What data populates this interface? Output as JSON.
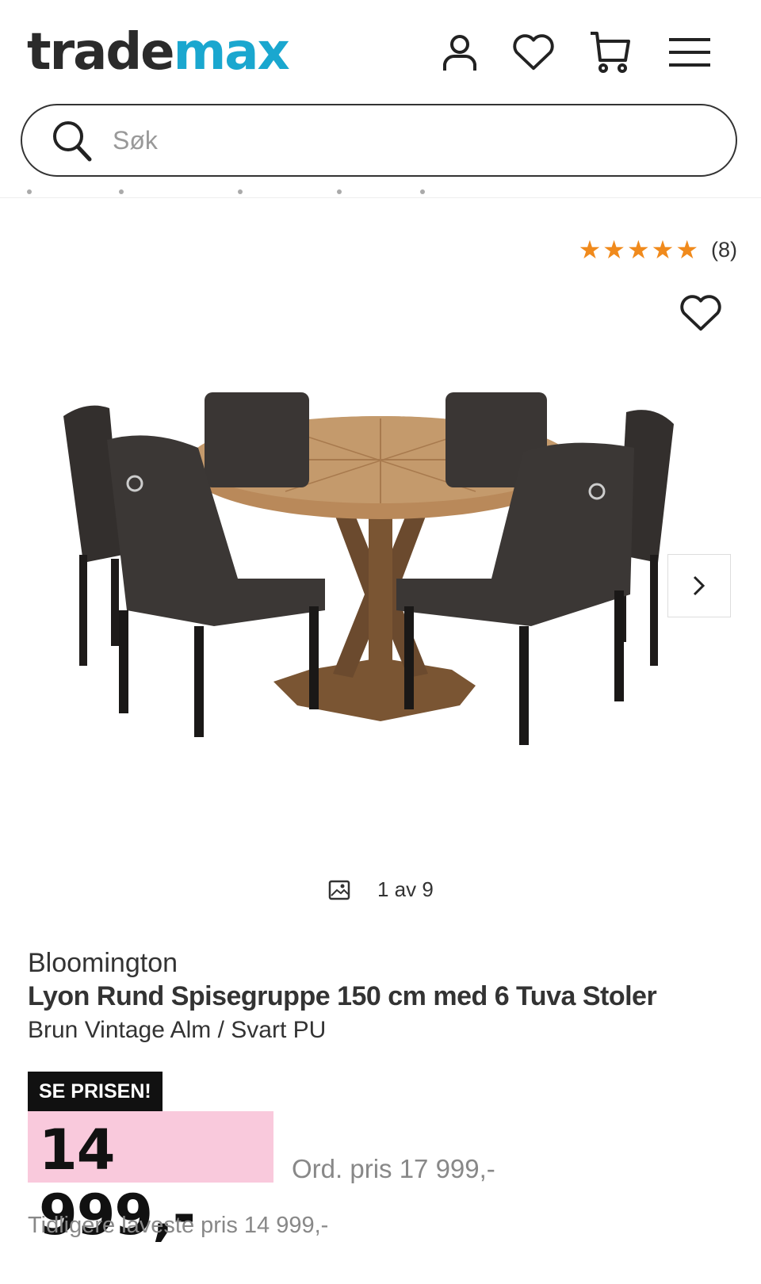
{
  "header": {
    "logo_part1": "trade",
    "logo_part2": "max",
    "search_placeholder": "Søk"
  },
  "rating": {
    "stars": "★★★★★",
    "value": 5,
    "count": "(8)"
  },
  "gallery": {
    "counter": "1 av 9"
  },
  "product": {
    "brand": "Bloomington",
    "title": "Lyon Rund Spisegruppe 150 cm med 6 Tuva Stoler",
    "variant": "Brun Vintage Alm / Svart PU",
    "badge": "SE PRISEN!",
    "price": "14 999,-",
    "ordinary_price": "Ord. pris 17 999,-",
    "lowest_price": "Tidligere laveste pris 14 999,-"
  },
  "colors": {
    "brand_blue": "#1aa7cf",
    "price_highlight": "#f9c9dc",
    "star": "#f08a1c"
  }
}
